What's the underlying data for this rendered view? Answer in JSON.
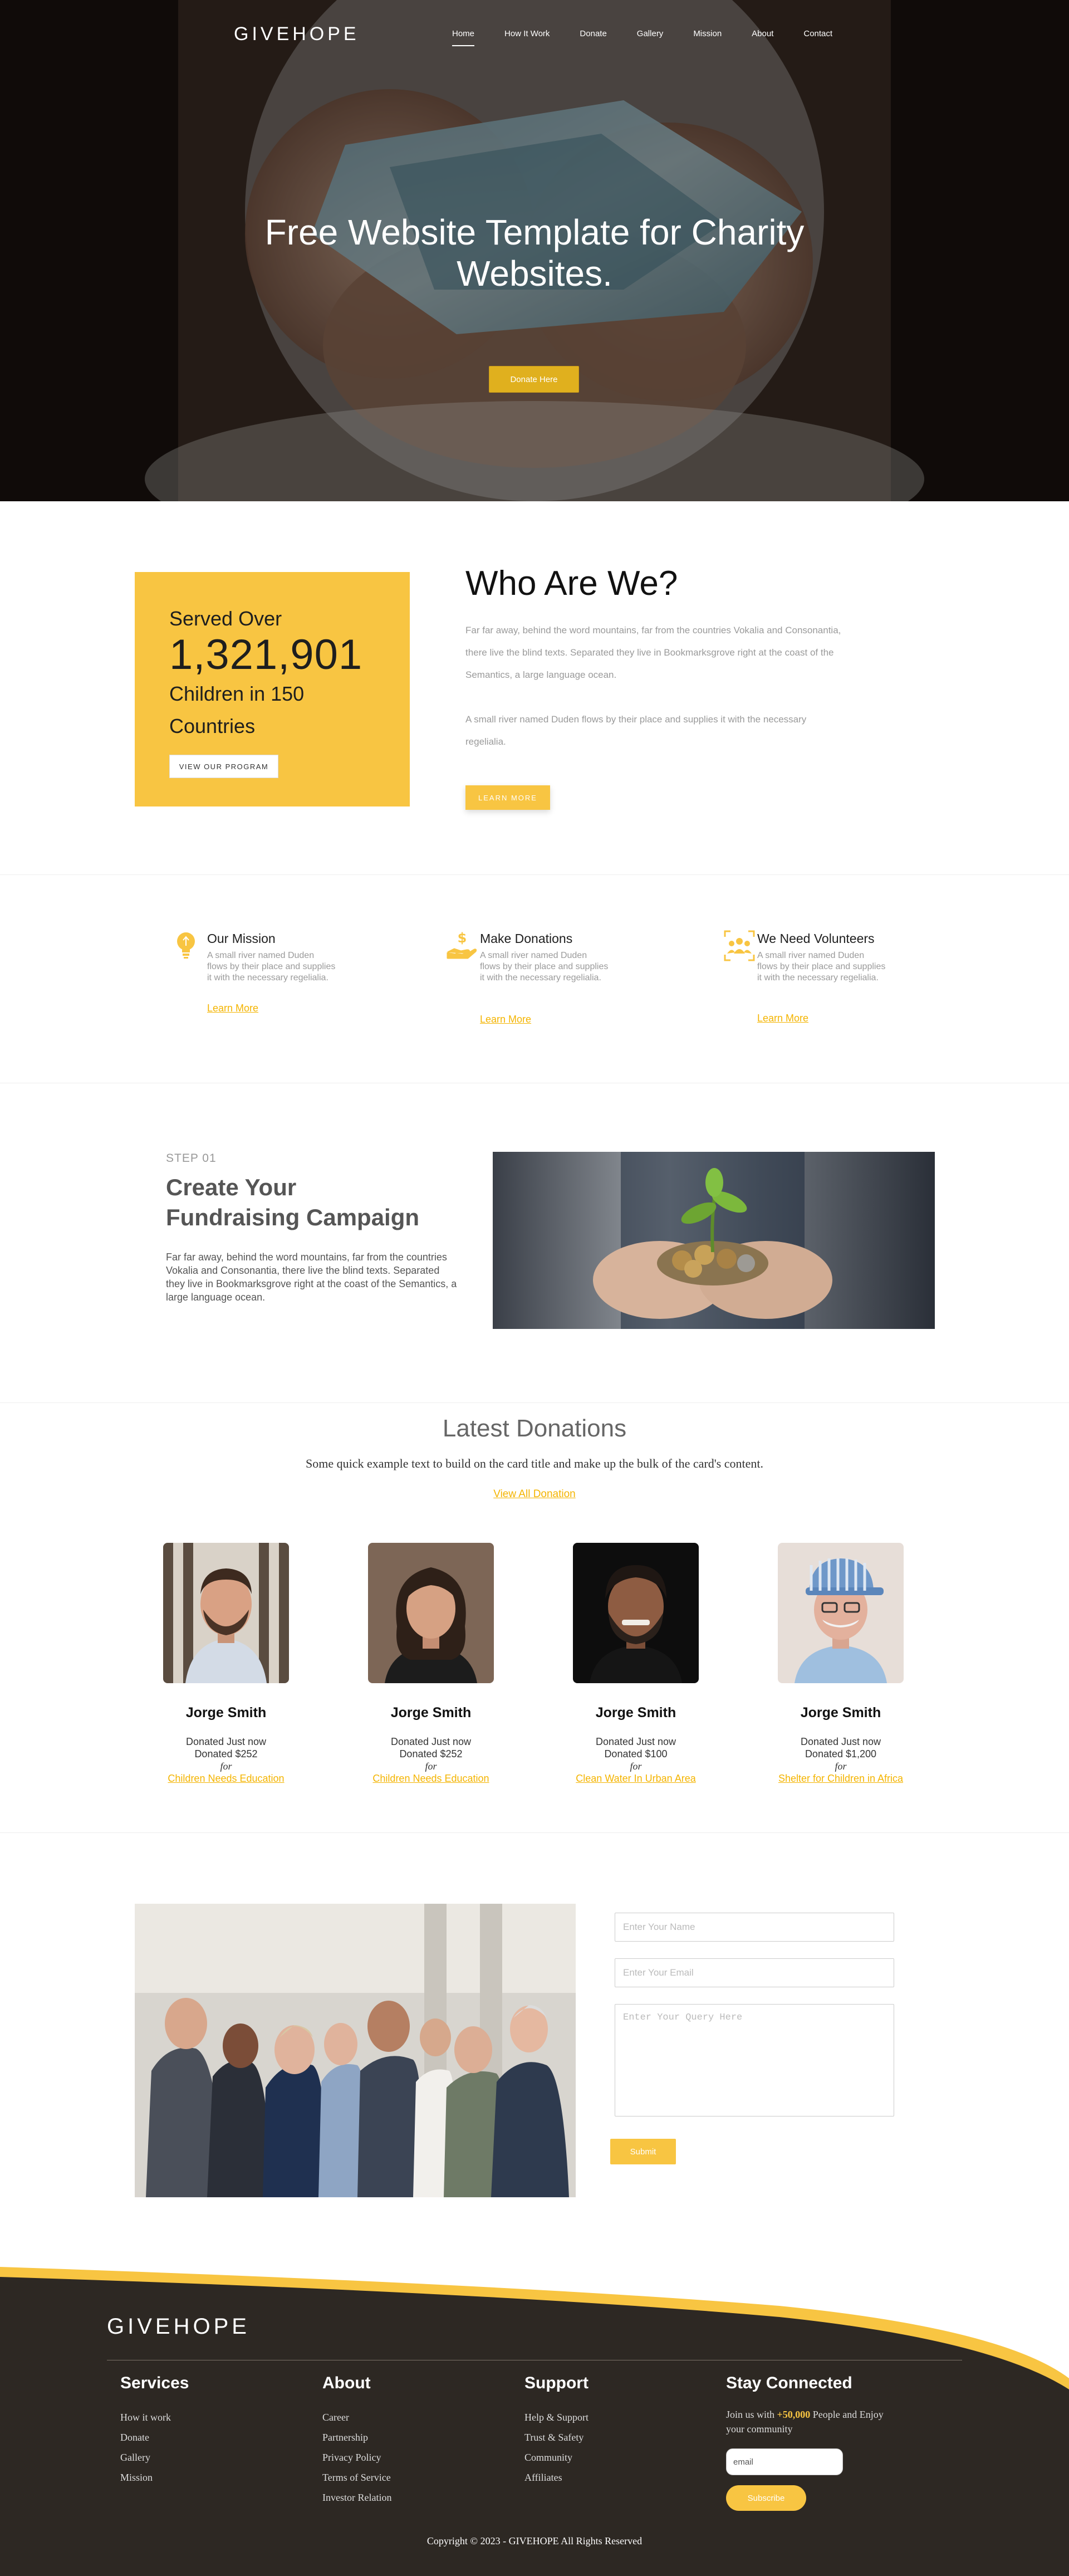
{
  "header": {
    "brand": "GIVEHOPE",
    "nav": [
      "Home",
      "How It Work",
      "Donate",
      "Gallery",
      "Mission",
      "About",
      "Contact"
    ],
    "active_nav": "Home"
  },
  "hero": {
    "title": "Free Website Template for Charity Websites.",
    "button": "Donate Here"
  },
  "who": {
    "served_line1": "Served Over",
    "served_number": "1,321,901",
    "served_line3": "Children in 150 Countries",
    "program_button": "VIEW OUR PROGRAM",
    "title": "Who Are We?",
    "para1": "Far far away, behind the word mountains, far from the countries Vokalia and Consonantia, there live the blind texts. Separated they live in Bookmarksgrove right at the coast of the Semantics, a large language ocean.",
    "para2": "A small river named Duden flows by their place and supplies it with the necessary regelialia.",
    "learn_button": "LEARN MORE"
  },
  "features": [
    {
      "icon": "lightbulb-icon",
      "title": "Our Mission",
      "text": "A small river named Duden flows by their place and supplies it with the necessary regelialia.",
      "link": "Learn More"
    },
    {
      "icon": "donation-hand-icon",
      "title": "Make Donations",
      "text": "A small river named Duden flows by their place and supplies it with the necessary regelialia.",
      "link": "Learn More"
    },
    {
      "icon": "volunteers-icon",
      "title": "We Need Volunteers",
      "text": "A small river named Duden flows by their place and supplies it with the necessary regelialia.",
      "link": "Learn More"
    }
  ],
  "step": {
    "label": "STEP 01",
    "title": "Create Your Fundraising Campaign",
    "text": "Far far away, behind the word mountains, far from the countries Vokalia and Consonantia, there live the blind texts. Separated they live in Bookmarksgrove right at the coast of the Semantics, a large language ocean."
  },
  "latest": {
    "title": "Latest Donations",
    "subtitle": "Some quick example text to build on the card title and make up the bulk of the card's content.",
    "link": "View All Donation",
    "donors": [
      {
        "name": "Jorge Smith",
        "line1": "Donated Just now",
        "amount": "Donated $252",
        "for": "for",
        "cause": "Children Needs Education"
      },
      {
        "name": "Jorge Smith",
        "line1": "Donated Just now",
        "amount": "Donated $252",
        "for": "for",
        "cause": "Children Needs Education"
      },
      {
        "name": "Jorge Smith",
        "line1": "Donated Just now",
        "amount": "Donated $100",
        "for": "for",
        "cause": "Clean Water In Urban Area"
      },
      {
        "name": "Jorge Smith",
        "line1": "Donated Just now",
        "amount": "Donated $1,200",
        "for": "for",
        "cause": "Shelter for Children in Africa"
      }
    ]
  },
  "contact": {
    "name_placeholder": "Enter Your Name",
    "email_placeholder": "Enter Your Email",
    "query_placeholder": "Enter Your Query Here",
    "submit": "Submit"
  },
  "footer": {
    "brand": "GIVEHOPE",
    "services": {
      "title": "Services",
      "links": [
        "How it work",
        "Donate",
        "Gallery",
        "Mission"
      ]
    },
    "about": {
      "title": "About",
      "links": [
        "Career",
        "Partnership",
        "Privacy Policy",
        "Terms of Service",
        "Investor Relation"
      ]
    },
    "support": {
      "title": "Support",
      "links": [
        "Help & Support",
        "Trust & Safety",
        "Community",
        "Affiliates"
      ]
    },
    "stay": {
      "title": "Stay Connected",
      "join_pre": "Join us with ",
      "join_count": "+50,000",
      "join_post": " People and Enjoy your community",
      "email_placeholder": "email",
      "subscribe": "Subscribe"
    },
    "copyright": "Copyright © 2023 - GIVEHOPE All Rights Reserved"
  },
  "colors": {
    "accent": "#f8c542",
    "accent_dark": "#e0b01e",
    "footer_bg": "#2d2823"
  }
}
